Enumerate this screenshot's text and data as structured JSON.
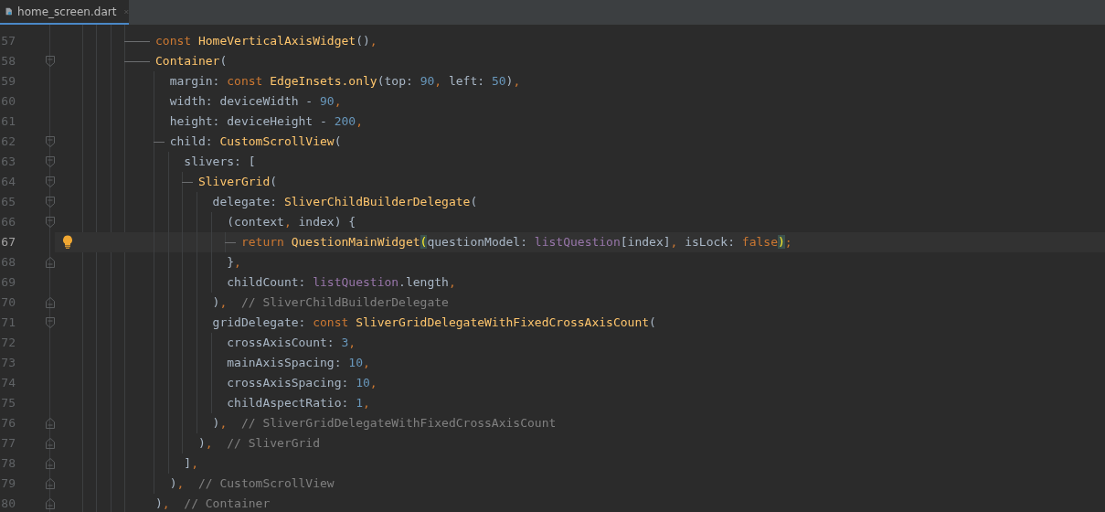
{
  "tab": {
    "title": "home_screen.dart",
    "selected": true
  },
  "lines": [
    {
      "number": "57",
      "fold_start": false,
      "fold_end": false,
      "branch": true,
      "current": false,
      "tokens": [
        {
          "kind": "kw",
          "text": "const "
        },
        {
          "kind": "cls",
          "text": "HomeVerticalAxisWidget"
        },
        {
          "kind": "txt",
          "text": "()"
        },
        {
          "kind": "punct",
          "text": ","
        }
      ]
    },
    {
      "number": "58",
      "fold_start": true,
      "fold_end": false,
      "branch": true,
      "current": false,
      "tokens": [
        {
          "kind": "cls",
          "text": "Container"
        },
        {
          "kind": "txt",
          "text": "("
        }
      ]
    },
    {
      "number": "59",
      "fold_start": false,
      "fold_end": false,
      "branch": false,
      "current": false,
      "tokens": [
        {
          "kind": "txt",
          "text": "  margin: "
        },
        {
          "kind": "kw",
          "text": "const "
        },
        {
          "kind": "cls",
          "text": "EdgeInsets.only"
        },
        {
          "kind": "txt",
          "text": "(top: "
        },
        {
          "kind": "num",
          "text": "90"
        },
        {
          "kind": "punct",
          "text": ", "
        },
        {
          "kind": "txt",
          "text": "left: "
        },
        {
          "kind": "num",
          "text": "50"
        },
        {
          "kind": "txt",
          "text": ")"
        },
        {
          "kind": "punct",
          "text": ","
        }
      ]
    },
    {
      "number": "60",
      "fold_start": false,
      "fold_end": false,
      "branch": false,
      "current": false,
      "tokens": [
        {
          "kind": "txt",
          "text": "  width: deviceWidth - "
        },
        {
          "kind": "num",
          "text": "90"
        },
        {
          "kind": "punct",
          "text": ","
        }
      ]
    },
    {
      "number": "61",
      "fold_start": false,
      "fold_end": false,
      "branch": false,
      "current": false,
      "tokens": [
        {
          "kind": "txt",
          "text": "  height: deviceHeight - "
        },
        {
          "kind": "num",
          "text": "200"
        },
        {
          "kind": "punct",
          "text": ","
        }
      ]
    },
    {
      "number": "62",
      "fold_start": true,
      "fold_end": false,
      "branch": true,
      "current": false,
      "tokens": [
        {
          "kind": "txt",
          "text": "  child: "
        },
        {
          "kind": "cls",
          "text": "CustomScrollView"
        },
        {
          "kind": "txt",
          "text": "("
        }
      ]
    },
    {
      "number": "63",
      "fold_start": true,
      "fold_end": false,
      "branch": false,
      "current": false,
      "tokens": [
        {
          "kind": "txt",
          "text": "    slivers: ["
        }
      ]
    },
    {
      "number": "64",
      "fold_start": true,
      "fold_end": false,
      "branch": true,
      "current": false,
      "tokens": [
        {
          "kind": "cls",
          "text": "      SliverGrid"
        },
        {
          "kind": "txt",
          "text": "("
        }
      ]
    },
    {
      "number": "65",
      "fold_start": true,
      "fold_end": false,
      "branch": false,
      "current": false,
      "tokens": [
        {
          "kind": "txt",
          "text": "        delegate: "
        },
        {
          "kind": "cls",
          "text": "SliverChildBuilderDelegate"
        },
        {
          "kind": "txt",
          "text": "("
        }
      ]
    },
    {
      "number": "66",
      "fold_start": true,
      "fold_end": false,
      "branch": false,
      "current": false,
      "tokens": [
        {
          "kind": "txt",
          "text": "          (context"
        },
        {
          "kind": "punct",
          "text": ", "
        },
        {
          "kind": "txt",
          "text": "index) {"
        }
      ]
    },
    {
      "number": "67",
      "fold_start": false,
      "fold_end": false,
      "branch": true,
      "current": true,
      "tokens": [
        {
          "kind": "kw",
          "text": "            return "
        },
        {
          "kind": "cls",
          "text": "QuestionMainWidget"
        },
        {
          "kind": "match",
          "text": "("
        },
        {
          "kind": "txt",
          "text": "questionModel: "
        },
        {
          "kind": "prop",
          "text": "listQuestion"
        },
        {
          "kind": "txt",
          "text": "[index]"
        },
        {
          "kind": "punct",
          "text": ", "
        },
        {
          "kind": "txt",
          "text": "isLock: "
        },
        {
          "kind": "kw",
          "text": "false"
        },
        {
          "kind": "match",
          "text": ")"
        },
        {
          "kind": "punct",
          "text": ";"
        }
      ]
    },
    {
      "number": "68",
      "fold_start": false,
      "fold_end": true,
      "branch": false,
      "current": false,
      "tokens": [
        {
          "kind": "txt",
          "text": "          }"
        },
        {
          "kind": "punct",
          "text": ","
        }
      ]
    },
    {
      "number": "69",
      "fold_start": false,
      "fold_end": false,
      "branch": false,
      "current": false,
      "tokens": [
        {
          "kind": "txt",
          "text": "          childCount: "
        },
        {
          "kind": "prop",
          "text": "listQuestion"
        },
        {
          "kind": "txt",
          "text": ".length"
        },
        {
          "kind": "punct",
          "text": ","
        }
      ]
    },
    {
      "number": "70",
      "fold_start": false,
      "fold_end": true,
      "branch": false,
      "current": false,
      "tokens": [
        {
          "kind": "txt",
          "text": "        )"
        },
        {
          "kind": "punct",
          "text": ","
        },
        {
          "kind": "cmt",
          "text": "  // SliverChildBuilderDelegate"
        }
      ]
    },
    {
      "number": "71",
      "fold_start": true,
      "fold_end": false,
      "branch": false,
      "current": false,
      "tokens": [
        {
          "kind": "txt",
          "text": "        gridDelegate: "
        },
        {
          "kind": "kw",
          "text": "const "
        },
        {
          "kind": "cls",
          "text": "SliverGridDelegateWithFixedCrossAxisCount"
        },
        {
          "kind": "txt",
          "text": "("
        }
      ]
    },
    {
      "number": "72",
      "fold_start": false,
      "fold_end": false,
      "branch": false,
      "current": false,
      "tokens": [
        {
          "kind": "txt",
          "text": "          crossAxisCount: "
        },
        {
          "kind": "num",
          "text": "3"
        },
        {
          "kind": "punct",
          "text": ","
        }
      ]
    },
    {
      "number": "73",
      "fold_start": false,
      "fold_end": false,
      "branch": false,
      "current": false,
      "tokens": [
        {
          "kind": "txt",
          "text": "          mainAxisSpacing: "
        },
        {
          "kind": "num",
          "text": "10"
        },
        {
          "kind": "punct",
          "text": ","
        }
      ]
    },
    {
      "number": "74",
      "fold_start": false,
      "fold_end": false,
      "branch": false,
      "current": false,
      "tokens": [
        {
          "kind": "txt",
          "text": "          crossAxisSpacing: "
        },
        {
          "kind": "num",
          "text": "10"
        },
        {
          "kind": "punct",
          "text": ","
        }
      ]
    },
    {
      "number": "75",
      "fold_start": false,
      "fold_end": false,
      "branch": false,
      "current": false,
      "tokens": [
        {
          "kind": "txt",
          "text": "          childAspectRatio: "
        },
        {
          "kind": "num",
          "text": "1"
        },
        {
          "kind": "punct",
          "text": ","
        }
      ]
    },
    {
      "number": "76",
      "fold_start": false,
      "fold_end": true,
      "branch": false,
      "current": false,
      "tokens": [
        {
          "kind": "txt",
          "text": "        )"
        },
        {
          "kind": "punct",
          "text": ","
        },
        {
          "kind": "cmt",
          "text": "  // SliverGridDelegateWithFixedCrossAxisCount"
        }
      ]
    },
    {
      "number": "77",
      "fold_start": false,
      "fold_end": true,
      "branch": false,
      "current": false,
      "tokens": [
        {
          "kind": "txt",
          "text": "      )"
        },
        {
          "kind": "punct",
          "text": ","
        },
        {
          "kind": "cmt",
          "text": "  // SliverGrid"
        }
      ]
    },
    {
      "number": "78",
      "fold_start": false,
      "fold_end": true,
      "branch": false,
      "current": false,
      "tokens": [
        {
          "kind": "txt",
          "text": "    ]"
        },
        {
          "kind": "punct",
          "text": ","
        }
      ]
    },
    {
      "number": "79",
      "fold_start": false,
      "fold_end": true,
      "branch": false,
      "current": false,
      "tokens": [
        {
          "kind": "txt",
          "text": "  )"
        },
        {
          "kind": "punct",
          "text": ","
        },
        {
          "kind": "cmt",
          "text": "  // CustomScrollView"
        }
      ]
    },
    {
      "number": "80",
      "fold_start": false,
      "fold_end": true,
      "branch": false,
      "current": false,
      "tokens": [
        {
          "kind": "txt",
          "text": ")"
        },
        {
          "kind": "punct",
          "text": ","
        },
        {
          "kind": "cmt",
          "text": "  // Container"
        }
      ]
    }
  ]
}
